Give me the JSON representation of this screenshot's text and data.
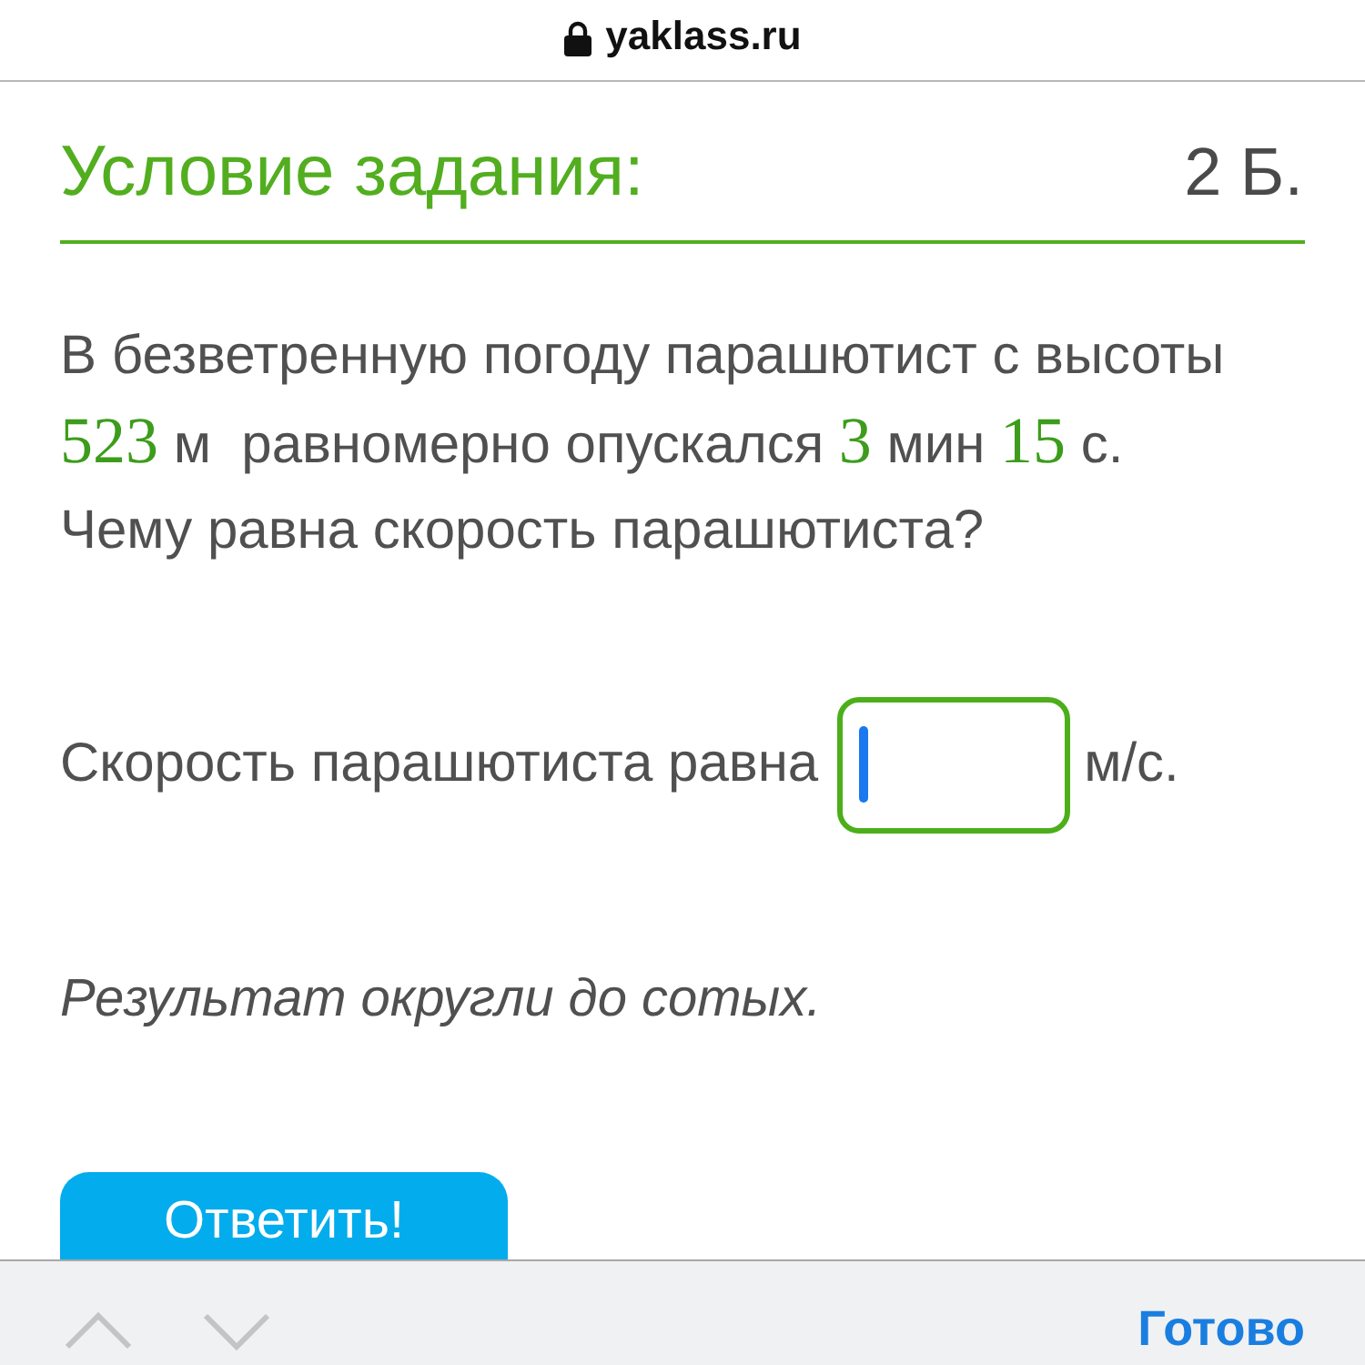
{
  "address_bar": {
    "secure": true,
    "url": "yaklass.ru"
  },
  "task": {
    "title": "Условие задания:",
    "points": "2 Б.",
    "question": [
      {
        "kind": "text",
        "text": "В безветренную погоду парашютист с высоты "
      },
      {
        "kind": "number",
        "text": "523"
      },
      {
        "kind": "text",
        "text": " м  равномерно опускался "
      },
      {
        "kind": "number",
        "text": "3"
      },
      {
        "kind": "text",
        "text": " мин "
      },
      {
        "kind": "number",
        "text": "15"
      },
      {
        "kind": "text",
        "text": " с. Чему равна скорость парашютиста?"
      }
    ],
    "answer": {
      "label": "Скорость парашютиста равна",
      "focused": true,
      "unit": "м/с."
    },
    "hint": "Результат округли до сотых.",
    "submit_button": "Ответить!"
  },
  "keyboard_toolbar": {
    "arrows": [
      {
        "kind": "up",
        "disabled": true
      },
      {
        "kind": "down",
        "disabled": true
      }
    ],
    "done_button": "Готово"
  }
}
